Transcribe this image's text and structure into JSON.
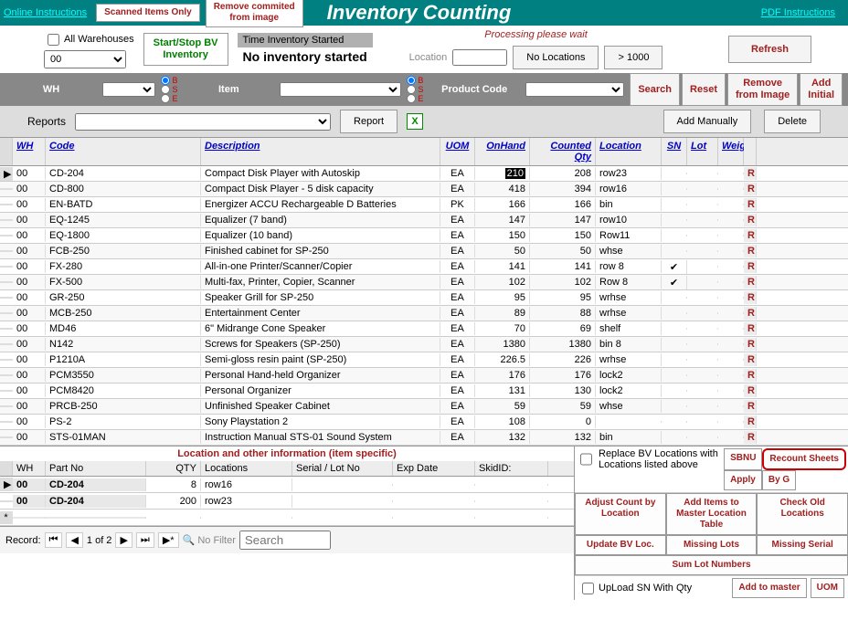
{
  "topbar": {
    "online": "Online Instructions",
    "scanned": "Scanned Items Only",
    "remove": "Remove commited\nfrom image",
    "title": "Inventory Counting",
    "pdf": "PDF Instructions"
  },
  "row2": {
    "allwh": "All Warehouses",
    "wh_value": "00",
    "startstop": "Start/Stop BV\nInventory",
    "timelbl": "Time Inventory Started",
    "noinv": "No inventory started",
    "processing": "Processing please wait",
    "location": "Location",
    "noloc": "No Locations",
    "gt1000": "> 1000",
    "refresh": "Refresh"
  },
  "gray": {
    "wh": "WH",
    "item": "Item",
    "prod": "Product Code",
    "search": "Search",
    "reset": "Reset",
    "remove": "Remove\nfrom Image",
    "add": "Add\nInitial",
    "r_b": "B",
    "r_s": "S",
    "r_e": "E"
  },
  "reports": {
    "lbl": "Reports",
    "btn": "Report",
    "addman": "Add Manually",
    "delete": "Delete"
  },
  "headers": {
    "wh": "WH",
    "code": "Code",
    "desc": "Description",
    "uom": "UOM",
    "onhand": "OnHand",
    "cqty": "Counted Qty",
    "loc": "Location",
    "sn": "SN",
    "lot": "Lot",
    "weig": "Weig"
  },
  "rows": [
    {
      "wh": "00",
      "code": "CD-204",
      "desc": "Compact Disk Player with Autoskip",
      "uom": "EA",
      "onhand": "210",
      "cqty": "208",
      "loc": "row23",
      "sn": false,
      "hl": true,
      "sel": "▶"
    },
    {
      "wh": "00",
      "code": "CD-800",
      "desc": "Compact Disk Player - 5 disk capacity",
      "uom": "EA",
      "onhand": "418",
      "cqty": "394",
      "loc": "row16",
      "sn": false
    },
    {
      "wh": "00",
      "code": "EN-BATD",
      "desc": "Energizer ACCU Rechargeable D Batteries",
      "uom": "PK",
      "onhand": "166",
      "cqty": "166",
      "loc": "bin",
      "sn": false
    },
    {
      "wh": "00",
      "code": "EQ-1245",
      "desc": "Equalizer (7 band)",
      "uom": "EA",
      "onhand": "147",
      "cqty": "147",
      "loc": "row10",
      "sn": false
    },
    {
      "wh": "00",
      "code": "EQ-1800",
      "desc": "Equalizer (10 band)",
      "uom": "EA",
      "onhand": "150",
      "cqty": "150",
      "loc": "Row11",
      "sn": false
    },
    {
      "wh": "00",
      "code": "FCB-250",
      "desc": "Finished cabinet for SP-250",
      "uom": "EA",
      "onhand": "50",
      "cqty": "50",
      "loc": "whse",
      "sn": false
    },
    {
      "wh": "00",
      "code": "FX-280",
      "desc": "All-in-one Printer/Scanner/Copier",
      "uom": "EA",
      "onhand": "141",
      "cqty": "141",
      "loc": "row 8",
      "sn": true
    },
    {
      "wh": "00",
      "code": "FX-500",
      "desc": "Multi-fax, Printer, Copier, Scanner",
      "uom": "EA",
      "onhand": "102",
      "cqty": "102",
      "loc": "Row 8",
      "sn": true
    },
    {
      "wh": "00",
      "code": "GR-250",
      "desc": "Speaker Grill for SP-250",
      "uom": "EA",
      "onhand": "95",
      "cqty": "95",
      "loc": "wrhse",
      "sn": false
    },
    {
      "wh": "00",
      "code": "MCB-250",
      "desc": "Entertainment Center",
      "uom": "EA",
      "onhand": "89",
      "cqty": "88",
      "loc": "wrhse",
      "sn": false
    },
    {
      "wh": "00",
      "code": "MD46",
      "desc": "6\" Midrange Cone Speaker",
      "uom": "EA",
      "onhand": "70",
      "cqty": "69",
      "loc": "shelf",
      "sn": false
    },
    {
      "wh": "00",
      "code": "N142",
      "desc": "Screws for Speakers (SP-250)",
      "uom": "EA",
      "onhand": "1380",
      "cqty": "1380",
      "loc": "bin 8",
      "sn": false
    },
    {
      "wh": "00",
      "code": "P1210A",
      "desc": "Semi-gloss resin paint (SP-250)",
      "uom": "EA",
      "onhand": "226.5",
      "cqty": "226",
      "loc": "wrhse",
      "sn": false
    },
    {
      "wh": "00",
      "code": "PCM3550",
      "desc": "Personal Hand-held Organizer",
      "uom": "EA",
      "onhand": "176",
      "cqty": "176",
      "loc": "lock2",
      "sn": false
    },
    {
      "wh": "00",
      "code": "PCM8420",
      "desc": "Personal Organizer",
      "uom": "EA",
      "onhand": "131",
      "cqty": "130",
      "loc": "lock2",
      "sn": false
    },
    {
      "wh": "00",
      "code": "PRCB-250",
      "desc": "Unfinished Speaker Cabinet",
      "uom": "EA",
      "onhand": "59",
      "cqty": "59",
      "loc": "whse",
      "sn": false
    },
    {
      "wh": "00",
      "code": "PS-2",
      "desc": "Sony Playstation 2",
      "uom": "EA",
      "onhand": "108",
      "cqty": "0",
      "loc": "",
      "sn": false
    },
    {
      "wh": "00",
      "code": "STS-01MAN",
      "desc": "Instruction Manual STS-01 Sound System",
      "uom": "EA",
      "onhand": "132",
      "cqty": "132",
      "loc": "bin",
      "sn": false
    }
  ],
  "locinfo": {
    "title": "Location and other information (item specific)",
    "hdr": {
      "wh": "WH",
      "part": "Part No",
      "qty": "QTY",
      "loc": "Locations",
      "ser": "Serial / Lot No",
      "exp": "Exp Date",
      "skid": "SkidID:"
    },
    "rows": [
      {
        "sel": "▶",
        "wh": "00",
        "part": "CD-204",
        "qty": "8",
        "loc": "row16"
      },
      {
        "sel": "",
        "wh": "00",
        "part": "CD-204",
        "qty": "200",
        "loc": "row23"
      },
      {
        "sel": "*",
        "wh": "",
        "part": "",
        "qty": "",
        "loc": ""
      }
    ]
  },
  "nav": {
    "label": "Record:",
    "pos": "1 of 2",
    "nofilter": "No Filter",
    "search": "Search"
  },
  "bright": {
    "replace": "Replace BV Locations with Locations listed above",
    "sbnu": "SBNU",
    "recount": "Recount Sheets",
    "apply": "Apply",
    "byg": "By G",
    "adjust": "Adjust Count by Location",
    "additems": "Add Items to Master Location Table",
    "checkold": "Check Old Locations",
    "updatebv": "Update BV Loc.",
    "missinglots": "Missing Lots",
    "missingserial": "Missing Serial",
    "sumlot": "Sum Lot Numbers",
    "upload": "UpLoad SN With Qty",
    "addmaster": "Add to master",
    "uom": "UOM"
  }
}
